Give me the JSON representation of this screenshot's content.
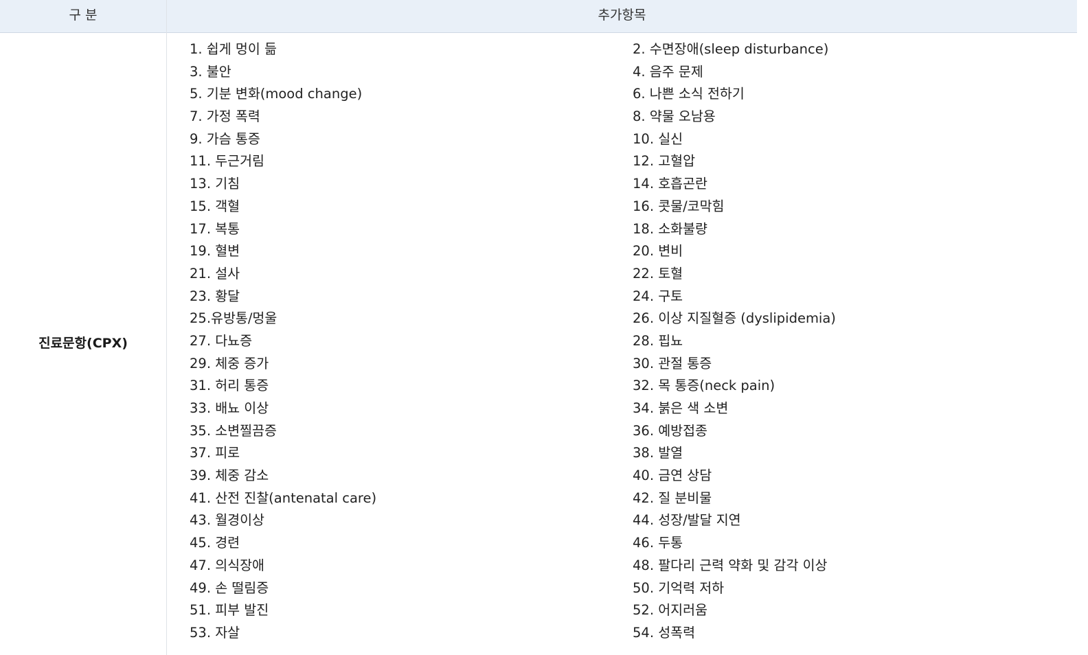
{
  "table": {
    "headers": [
      "구 분",
      "추가항목"
    ],
    "row_label": "진료문항(CPX)",
    "items": [
      "1. 쉽게 멍이 듦",
      "2. 수면장애(sleep disturbance)",
      "3. 불안",
      "4. 음주 문제",
      "5. 기분 변화(mood change)",
      "6. 나쁜 소식 전하기",
      "7. 가정 폭력",
      "8. 약물 오남용",
      "9. 가슴 통증",
      "10. 실신",
      "11. 두근거림",
      "12. 고혈압",
      "13. 기침",
      "14. 호흡곤란",
      "15. 객혈",
      "16. 콧물/코막힘",
      "17. 복통",
      "18. 소화불량",
      "19. 혈변",
      "20. 변비",
      "21. 설사",
      "22. 토혈",
      "23. 황달",
      "24. 구토",
      "25.유방통/멍울",
      "26. 이상 지질혈증 (dyslipidemia)",
      "27. 다뇨증",
      "28. 핍뇨",
      "29. 체중 증가",
      "30. 관절 통증",
      "31. 허리 통증",
      "32. 목 통증(neck pain)",
      "33. 배뇨 이상",
      "34. 붉은 색 소변",
      "35. 소변찔끔증",
      "36. 예방접종",
      "37. 피로",
      "38. 발열",
      "39. 체중 감소",
      "40. 금연 상담",
      "41. 산전 진찰(antenatal care)",
      "42. 질 분비물",
      "43. 월경이상",
      "44. 성장/발달 지연",
      "45. 경련",
      "46. 두통",
      "47. 의식장애",
      "48. 팔다리 근력 약화 및 감각 이상",
      "49. 손 떨림증",
      "50. 기억력 저하",
      "51. 피부 발진",
      "52. 어지러움",
      "53. 자살",
      "54. 성폭력"
    ]
  }
}
